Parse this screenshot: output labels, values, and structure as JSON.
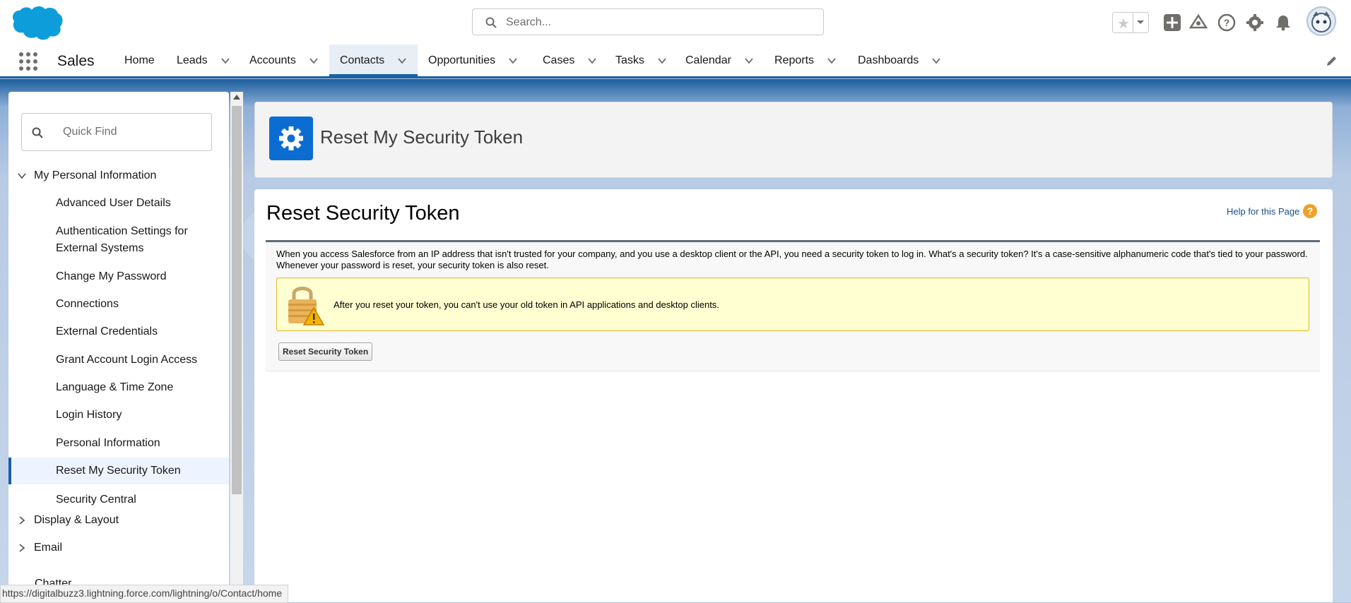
{
  "header": {
    "search_placeholder": "Search..."
  },
  "nav": {
    "app_name": "Sales",
    "items": [
      {
        "label": "Home"
      },
      {
        "label": "Leads"
      },
      {
        "label": "Accounts"
      },
      {
        "label": "Contacts"
      },
      {
        "label": "Opportunities"
      },
      {
        "label": "Cases"
      },
      {
        "label": "Tasks"
      },
      {
        "label": "Calendar"
      },
      {
        "label": "Reports"
      },
      {
        "label": "Dashboards"
      }
    ],
    "active": "Contacts"
  },
  "sidebar": {
    "quick_find_placeholder": "Quick Find",
    "section_personal": "My Personal Information",
    "items": [
      "Advanced User Details",
      "Authentication Settings for External Systems",
      "Change My Password",
      "Connections",
      "External Credentials",
      "Grant Account Login Access",
      "Language & Time Zone",
      "Login History",
      "Personal Information",
      "Reset My Security Token",
      "Security Central"
    ],
    "selected": "Reset My Security Token",
    "section_display": "Display & Layout",
    "section_email": "Email",
    "section_chatter_partial": "Chatter"
  },
  "page_header": {
    "title": "Reset My Security Token"
  },
  "content": {
    "heading": "Reset Security Token",
    "help_link": "Help for this Page",
    "help_icon_glyph": "?",
    "description": "When you access Salesforce from an IP address that isn't trusted for your company, and you use a desktop client or the API, you need a security token to log in. What's a security token? It's a case-sensitive alphanumeric code that's tied to your password. Whenever your password is reset, your security token is also reset.",
    "warning": "After you reset your token, you can't use your old token in API applications and desktop clients.",
    "button_label": "Reset Security Token"
  },
  "status_url": "https://digitalbuzz3.lightning.force.com/lightning/o/Contact/home",
  "colors": {
    "brand": "#1b5fa6",
    "page_icon": "#0b6dd2",
    "warning_bg": "#ffffd1"
  }
}
